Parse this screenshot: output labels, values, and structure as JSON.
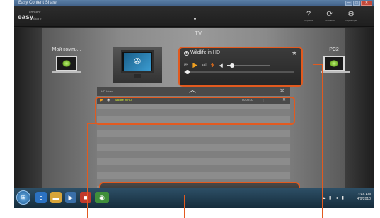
{
  "window": {
    "title": "Easy Content Share",
    "controls": [
      "—",
      "□",
      "✕"
    ]
  },
  "app": {
    "logo_top": "content",
    "logo_main": "easy",
    "logo_sub": "share",
    "header_buttons": [
      {
        "icon": "?",
        "label": "Справка",
        "name": "help"
      },
      {
        "icon": "⟳",
        "label": "Обновить",
        "name": "refresh"
      },
      {
        "icon": "⚙",
        "label": "Параметры",
        "name": "settings"
      }
    ]
  },
  "workspace": {
    "tv_label": "TV",
    "left_device_label": "Мой компь...",
    "right_device_label": "PC2"
  },
  "player": {
    "title": "Wildlife in HD",
    "volume_fraction": 0.12,
    "progress_fraction": 0.03
  },
  "playlist": {
    "header_label": "HD Video",
    "items": [
      {
        "title": "Wildlife in HD",
        "duration": "00:00:30"
      }
    ],
    "add_label": "+"
  },
  "taskbar": {
    "clock_time": "3:46 AM",
    "clock_date": "4/9/2010"
  },
  "colors": {
    "callout": "#e25a1f",
    "play_accent": "#f0a020",
    "now_playing_text": "#d6f03a"
  }
}
